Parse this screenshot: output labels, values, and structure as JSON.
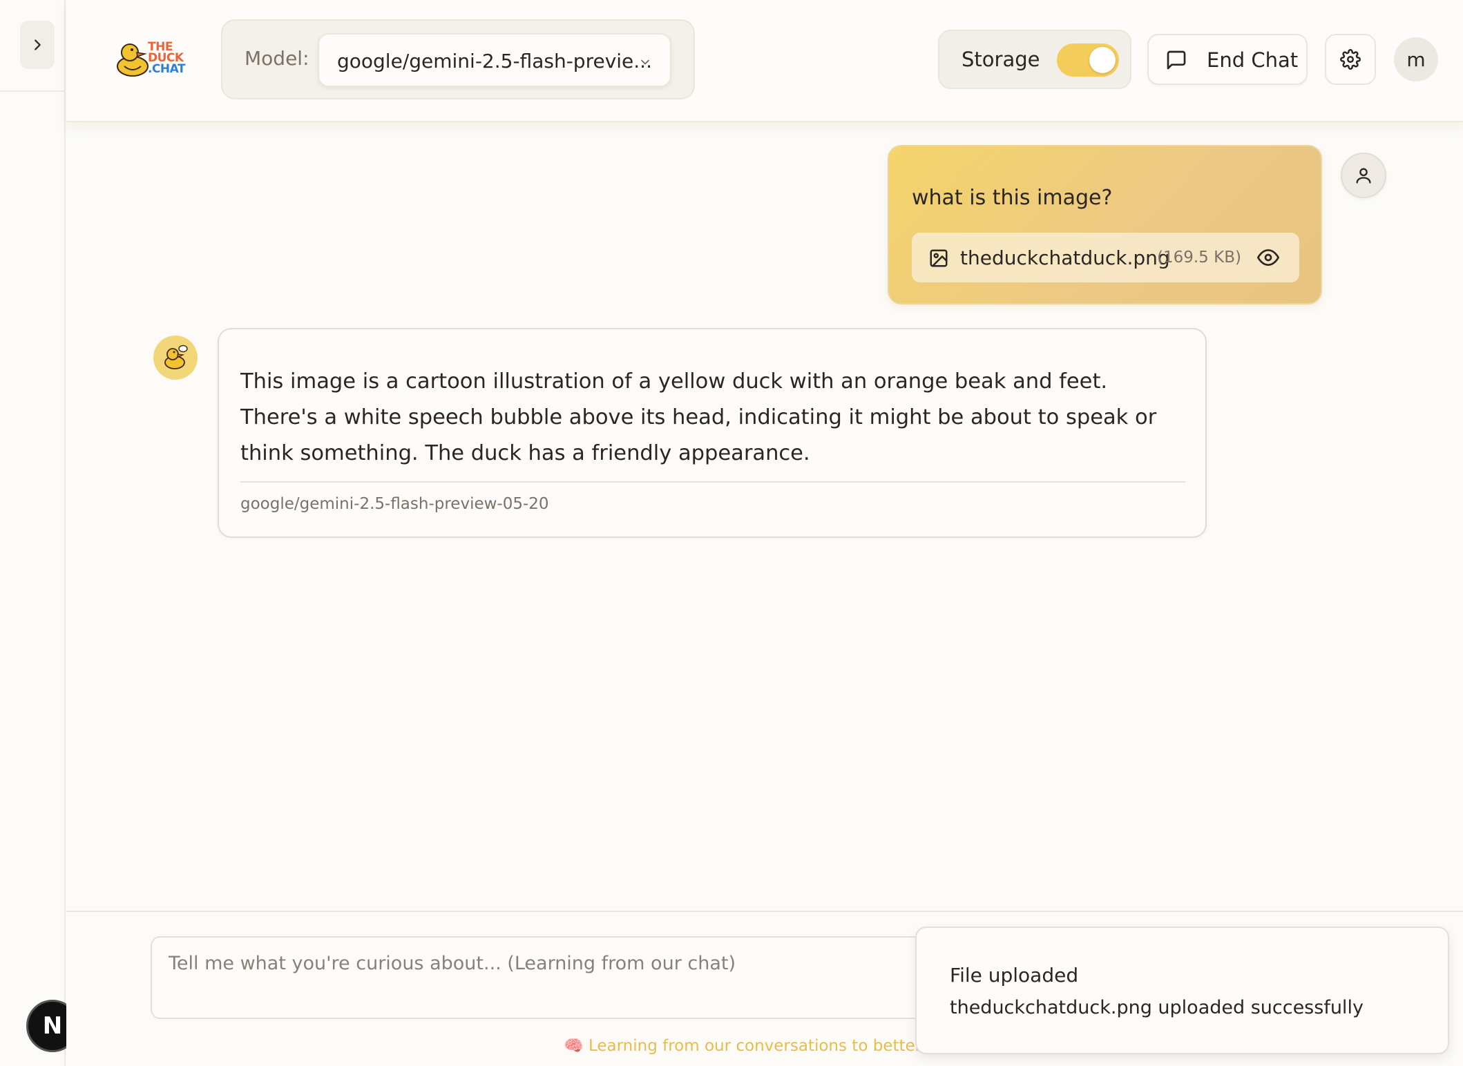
{
  "colors": {
    "accent_yellow": "#f3cc5a",
    "background": "#fcfbf8",
    "logo_orange": "#e8663a",
    "logo_blue": "#2f7fd8"
  },
  "logo": {
    "lines": [
      "THE",
      "DUCK",
      ".CHAT"
    ]
  },
  "header": {
    "model_label": "Model:",
    "model_value": "google/gemini-2.5-flash-previe...",
    "storage_label": "Storage",
    "storage_on": true,
    "end_chat_label": "End Chat",
    "avatar_initial": "m"
  },
  "messages": {
    "user": {
      "text": "what is this image?",
      "attachment": {
        "name": "theduckchatduck.png",
        "size": "(169.5 KB)"
      }
    },
    "assistant": {
      "text": "This image is a cartoon illustration of a yellow duck with an orange beak and feet. There's a white speech bubble above its head, indicating it might be about to speak or think something. The duck has a friendly appearance.",
      "model": "google/gemini-2.5-flash-preview-05-20"
    }
  },
  "composer": {
    "placeholder": "Tell me what you're curious about... (Learning from our chat)",
    "learning_note": "🧠 Learning from our conversations to better as"
  },
  "toast": {
    "title": "File uploaded",
    "message": "theduckchatduck.png uploaded successfully"
  },
  "badge": {
    "letter": "N"
  },
  "icons": {
    "sidebar_toggle": "chevron-right-icon",
    "model_dropdown": "chevron-down-icon",
    "end_chat": "message-square-icon",
    "settings": "gear-icon",
    "attachment": "image-icon",
    "preview": "eye-icon",
    "user": "user-icon",
    "bot": "duck-icon"
  }
}
